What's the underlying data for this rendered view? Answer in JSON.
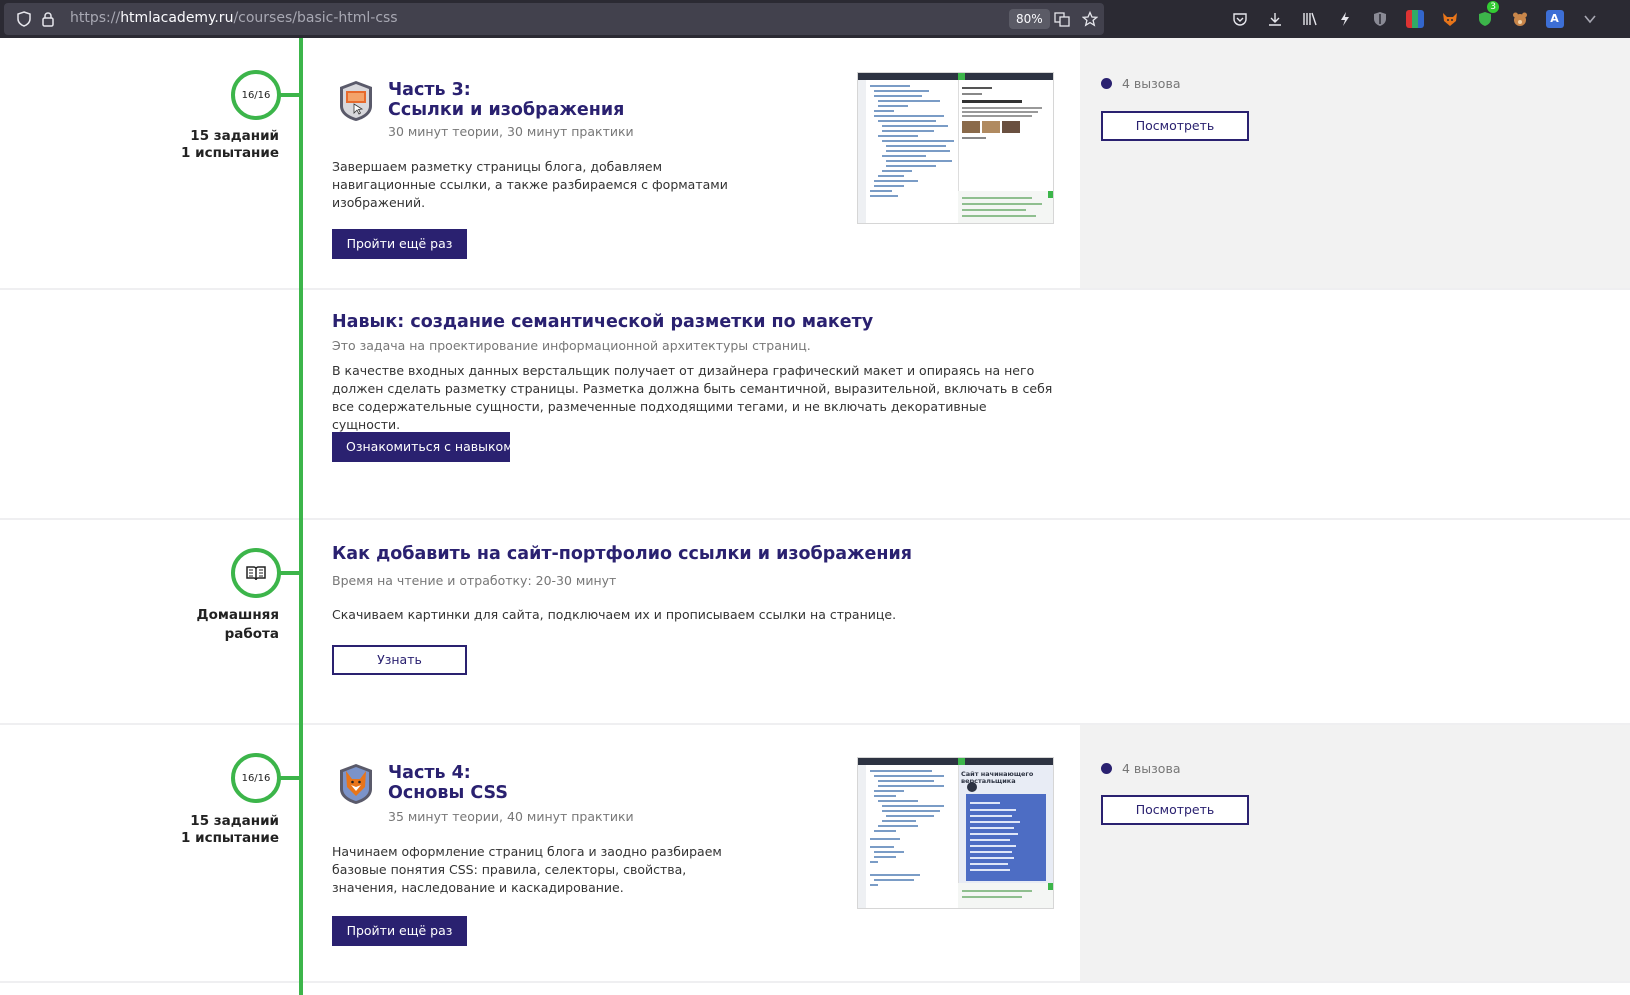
{
  "browser": {
    "url_base": "https://",
    "url_host": "htmlacademy.ru",
    "url_path": "/courses/basic-html-css",
    "zoom": "80%",
    "toolbar_icons": [
      "pocket-icon",
      "download-icon",
      "library-icon",
      "lightning-icon",
      "shield-icon",
      "tabs-grid-icon",
      "fox-icon",
      "extension-green-icon",
      "bear-icon",
      "translate-icon",
      "chevron-down-icon"
    ],
    "extension_badge": "3"
  },
  "sections": {
    "part3": {
      "progress": "16/16",
      "tasks": "15 заданий",
      "trial": "1 испытание",
      "title_line1": "Часть 3:",
      "title_line2": "Ссылки и изображения",
      "duration": "30 минут теории, 30 минут практики",
      "description": "Завершаем разметку страницы блога, добавляем навигационные ссылки, а также разбираемся с форматами изображений.",
      "button": "Пройти ещё раз",
      "challenges": "4 вызова",
      "view_button": "Посмотреть"
    },
    "skill": {
      "title": "Навык: создание семантической разметки по макету",
      "subtitle": "Это задача на проектирование информационной архитектуры страниц.",
      "description": "В качестве входных данных верстальщик получает от дизайнера графический макет и опираясь на него должен сделать разметку страницы. Разметка должна быть семантичной, выразительной, включать в себя все содержательные сущности, размеченные подходящими тегами, и не включать декоративные сущности.",
      "button": "Ознакомиться с навыком"
    },
    "homework": {
      "label_line1": "Домашняя",
      "label_line2": "работа",
      "title": "Как добавить на сайт-портфолио ссылки и изображения",
      "subtitle": "Время на чтение и отработку: 20-30 минут",
      "description": "Скачиваем картинки для сайта, подключаем их и прописываем ссылки на странице.",
      "button": "Узнать"
    },
    "part4": {
      "progress": "16/16",
      "tasks": "15 заданий",
      "trial": "1 испытание",
      "title_line1": "Часть 4:",
      "title_line2": "Основы CSS",
      "duration": "35 минут теории, 40 минут практики",
      "description": "Начинаем оформление страниц блога и заодно разбираем базовые понятия CSS: правила, селекторы, свойства, значения, наследование и каскадирование.",
      "button": "Пройти ещё раз",
      "challenges": "4 вызова",
      "view_button": "Посмотреть",
      "preview_heading": "Сайт начинающего верстальщика"
    }
  }
}
